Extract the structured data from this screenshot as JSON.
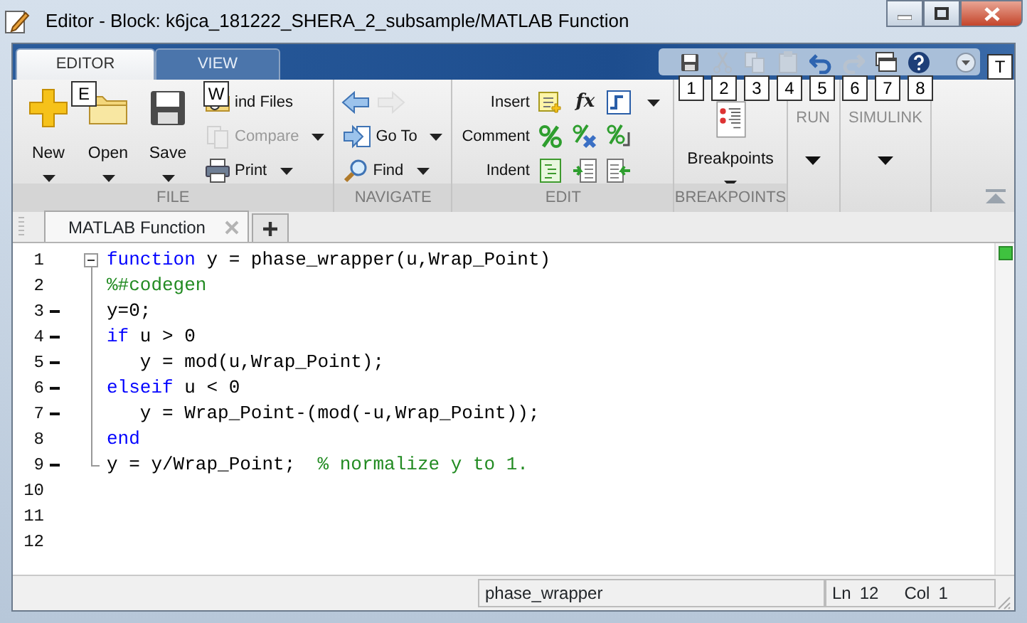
{
  "window": {
    "title": "Editor - Block: k6jca_181222_SHERA_2_subsample/MATLAB Function"
  },
  "ribbon_tabs": [
    {
      "label": "EDITOR",
      "selected": true,
      "keytip": "E"
    },
    {
      "label": "VIEW",
      "selected": false,
      "keytip": "W"
    }
  ],
  "quick_access": [
    {
      "kind": "save",
      "disabled": false,
      "keytip": "1"
    },
    {
      "kind": "cut",
      "disabled": true,
      "keytip": "2"
    },
    {
      "kind": "copy",
      "disabled": true,
      "keytip": "3"
    },
    {
      "kind": "paste",
      "disabled": true,
      "keytip": "4"
    },
    {
      "kind": "undo",
      "disabled": false,
      "keytip": "5"
    },
    {
      "kind": "redo",
      "disabled": true,
      "keytip": "6"
    },
    {
      "kind": "windows",
      "disabled": false,
      "keytip": "7"
    },
    {
      "kind": "help",
      "disabled": false,
      "keytip": "8"
    }
  ],
  "ribbon_keytip": "T",
  "sections": [
    {
      "kind": "file",
      "label": "FILE",
      "big_buttons": [
        {
          "kind": "new",
          "label": "New"
        },
        {
          "kind": "open",
          "label": "Open"
        },
        {
          "kind": "save",
          "label": "Save"
        }
      ],
      "small_buttons": [
        {
          "kind": "find-files",
          "label": "ind Files",
          "disabled": false,
          "dropdown": false
        },
        {
          "kind": "compare",
          "label": "Compare",
          "disabled": true,
          "dropdown": true
        },
        {
          "kind": "print",
          "label": "Print",
          "disabled": false,
          "dropdown": true
        }
      ]
    },
    {
      "kind": "navigate",
      "label": "NAVIGATE",
      "arrows": [
        {
          "kind": "back",
          "disabled": false
        },
        {
          "kind": "forward",
          "disabled": true
        }
      ],
      "small_buttons": [
        {
          "kind": "goto",
          "label": "Go To",
          "disabled": false,
          "dropdown": true
        },
        {
          "kind": "find",
          "label": "Find",
          "disabled": false,
          "dropdown": true
        }
      ]
    },
    {
      "kind": "edit",
      "label": "EDIT",
      "rows": [
        {
          "label": "Insert",
          "dropdown": true,
          "icons": [
            {
              "kind": "insert-section"
            },
            {
              "kind": "text",
              "text": "fx"
            },
            {
              "kind": "fi"
            }
          ]
        },
        {
          "label": "Comment",
          "dropdown": false,
          "icons": [
            {
              "kind": "comment"
            },
            {
              "kind": "uncomment"
            },
            {
              "kind": "wrap-comment"
            }
          ]
        },
        {
          "label": "Indent",
          "dropdown": false,
          "icons": [
            {
              "kind": "smart-indent"
            },
            {
              "kind": "indent"
            },
            {
              "kind": "outdent"
            }
          ]
        }
      ]
    },
    {
      "kind": "breakpoints",
      "label": "BREAKPOINTS",
      "big_buttons": [
        {
          "kind": "breakpoints",
          "label": "Breakpoints"
        }
      ]
    },
    {
      "kind": "collapsed",
      "title": "RUN"
    },
    {
      "kind": "collapsed",
      "title": "SIMULINK"
    }
  ],
  "editor_tabs": [
    {
      "label": "MATLAB Function",
      "selected": true
    }
  ],
  "code_lines": [
    {
      "number": "1",
      "executable": false,
      "kind": "fold-start",
      "tokens": [
        {
          "kind": "keyword",
          "text": "function"
        },
        {
          "kind": "plain",
          "text": " y = phase_wrapper(u,Wrap_Point)"
        }
      ]
    },
    {
      "number": "2",
      "executable": false,
      "kind": "fold-inner",
      "tokens": [
        {
          "kind": "comment",
          "text": "%#codegen"
        }
      ]
    },
    {
      "number": "3",
      "executable": true,
      "kind": "fold-inner",
      "tokens": [
        {
          "kind": "plain",
          "text": "y=0;"
        }
      ]
    },
    {
      "number": "4",
      "executable": true,
      "kind": "fold-inner",
      "tokens": [
        {
          "kind": "keyword",
          "text": "if"
        },
        {
          "kind": "plain",
          "text": " u > 0"
        }
      ]
    },
    {
      "number": "5",
      "executable": true,
      "kind": "fold-inner",
      "tokens": [
        {
          "kind": "plain",
          "text": "   y = mod(u,Wrap_Point);"
        }
      ]
    },
    {
      "number": "6",
      "executable": true,
      "kind": "fold-inner",
      "tokens": [
        {
          "kind": "keyword",
          "text": "elseif"
        },
        {
          "kind": "plain",
          "text": " u < 0"
        }
      ]
    },
    {
      "number": "7",
      "executable": true,
      "kind": "fold-inner",
      "tokens": [
        {
          "kind": "plain",
          "text": "   y = Wrap_Point-(mod(-u,Wrap_Point));"
        }
      ]
    },
    {
      "number": "8",
      "executable": false,
      "kind": "fold-inner",
      "tokens": [
        {
          "kind": "keyword",
          "text": "end"
        }
      ]
    },
    {
      "number": "9",
      "executable": true,
      "kind": "fold-end",
      "tokens": [
        {
          "kind": "plain",
          "text": "y = y/Wrap_Point;  "
        },
        {
          "kind": "comment",
          "text": "% normalize y to 1."
        }
      ]
    },
    {
      "number": "10",
      "executable": false,
      "kind": "plain"
    },
    {
      "number": "11",
      "executable": false,
      "kind": "plain"
    },
    {
      "number": "12",
      "executable": false,
      "kind": "plain"
    }
  ],
  "status_bar": {
    "function_name": "phase_wrapper",
    "ln_label": "Ln",
    "ln": "12",
    "col_label": "Col",
    "col": "1"
  }
}
